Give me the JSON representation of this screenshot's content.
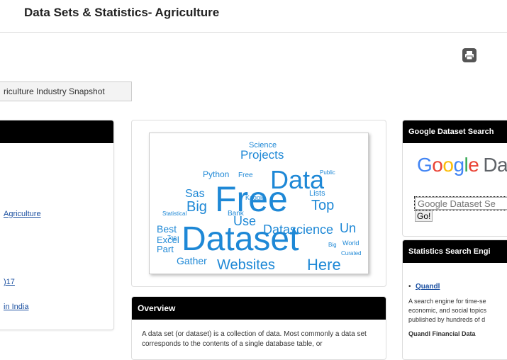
{
  "page": {
    "title": "Data Sets & Statistics- Agriculture"
  },
  "toolbar": {
    "print_icon": "print-icon"
  },
  "tabs": [
    {
      "label": "riculture Industry Snapshot"
    }
  ],
  "left_box": {
    "links": [
      {
        "label": "Agriculture"
      },
      {
        "label": ")17"
      },
      {
        "label": "in India"
      }
    ]
  },
  "wordcloud": {
    "words": [
      "Dataset",
      "Free",
      "Data",
      "Websites",
      "Here",
      "Big",
      "Datascience",
      "Projects",
      "Use",
      "Top",
      "Sas",
      "Best",
      "Un",
      "Part",
      "Excel",
      "Gather",
      "Python",
      "Science",
      "Lists",
      "Bank",
      "World",
      "Kaggle",
      "Statistical",
      "Public",
      "Curated"
    ],
    "fill": "#1e88d6"
  },
  "overview": {
    "heading": "Overview",
    "text": "A data set (or dataset) is a collection of data. Most commonly a data set corresponds to the contents of a single database table, or"
  },
  "google_box": {
    "heading": "Google Dataset Search",
    "logo_word": "Google",
    "logo_suffix": "Da",
    "input_placeholder": "Google Dataset Se",
    "go_label": "Go!",
    "logo_colors": [
      "#4285F4",
      "#EA4335",
      "#FBBC05",
      "#4285F4",
      "#34A853",
      "#EA4335"
    ],
    "suffix_color": "#5f6368"
  },
  "stats_box": {
    "heading": "Statistics Search Engi",
    "link": "Quandl",
    "description": "A search engine for time-se economic, and social topics published by hundreds of d",
    "subheading": "Quandl Financial Data"
  }
}
